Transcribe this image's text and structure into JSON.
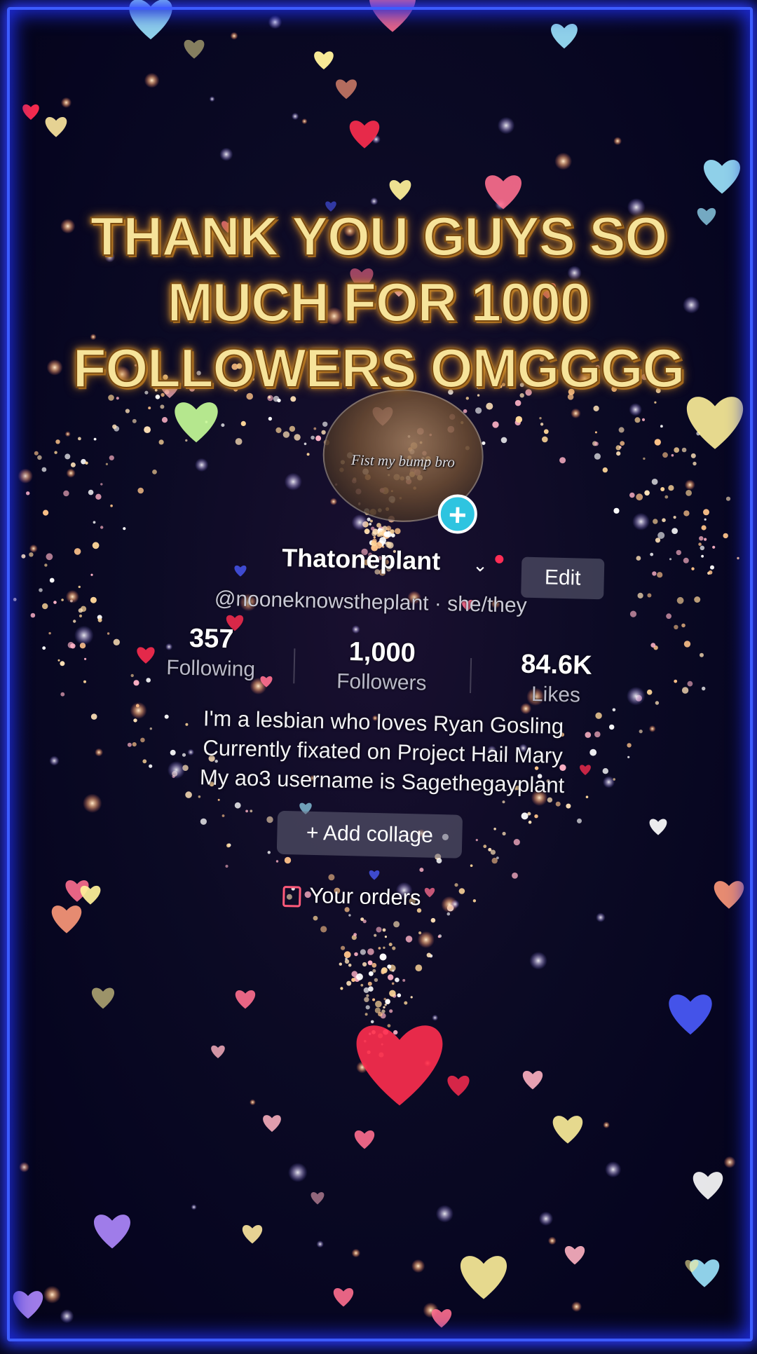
{
  "overlay": {
    "caption_lines": [
      "THANK YOU GUYS SO",
      "MUCH FOR 1000",
      "FOLLOWERS OMGGGG"
    ]
  },
  "profile": {
    "avatar_caption": "Fist my bump bro",
    "display_name": "Thatoneplant",
    "edit_label": "Edit",
    "handle_text": "@nooneknowstheplant · she/they",
    "stats": [
      {
        "value": "357",
        "label": "Following"
      },
      {
        "value": "1,000",
        "label": "Followers"
      },
      {
        "value": "84.6K",
        "label": "Likes"
      }
    ],
    "bio_lines": [
      "I'm a lesbian who loves Ryan Gosling",
      "Currently fixated on Project Hail Mary",
      "My ao3 username is Sagethegayplant"
    ],
    "add_collage_label": "+ Add collage",
    "your_orders_label": "Your orders"
  },
  "colors": {
    "frame": "#3d5cff",
    "caption_fill": "#f6e39a",
    "plus_button": "#2ec4e0",
    "notification_dot": "#ff2d55"
  },
  "icons": [
    "plus-icon",
    "chevron-down-icon",
    "orders-bag-icon"
  ]
}
